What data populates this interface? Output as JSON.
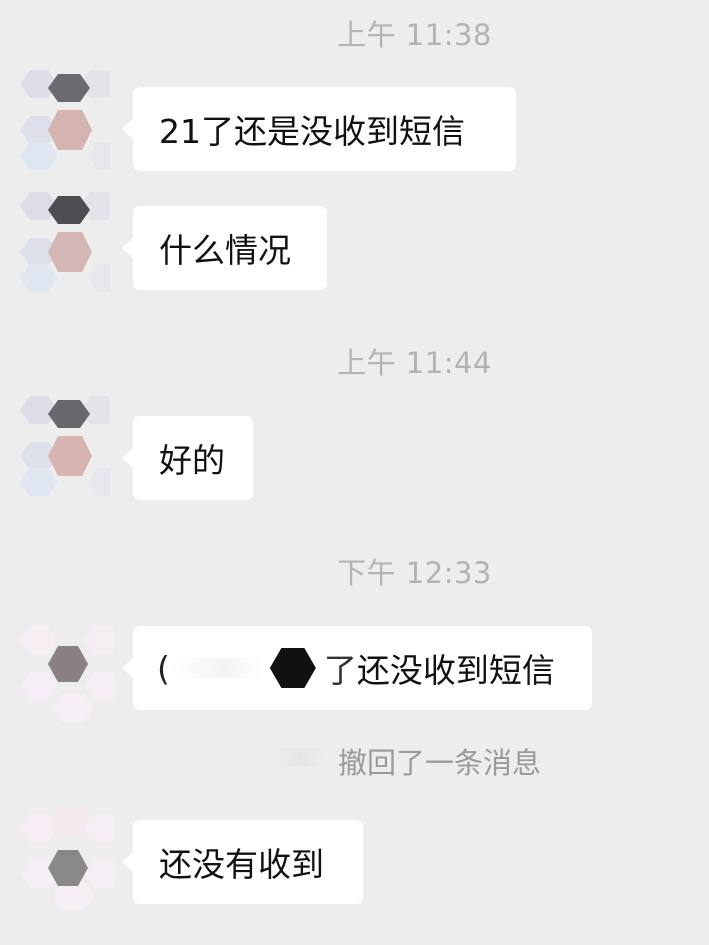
{
  "chat": {
    "timestamps": [
      "上午 11:38",
      "上午 11:44",
      "下午 12:33"
    ],
    "messages": [
      "21了还是没收到短信",
      "什么情况",
      "好的",
      "还没收到短信",
      "还没有收到"
    ],
    "recall_notice": "撤回了一条消息",
    "redacted_prefix": "(",
    "redacted_tail": "了"
  },
  "colors": {
    "background": "#ededed",
    "bubble": "#ffffff",
    "timestamp_text": "#b3b3b3",
    "message_text": "#111111"
  },
  "icons": {
    "avatar": "blurred-hexagon-avatar-icon"
  }
}
